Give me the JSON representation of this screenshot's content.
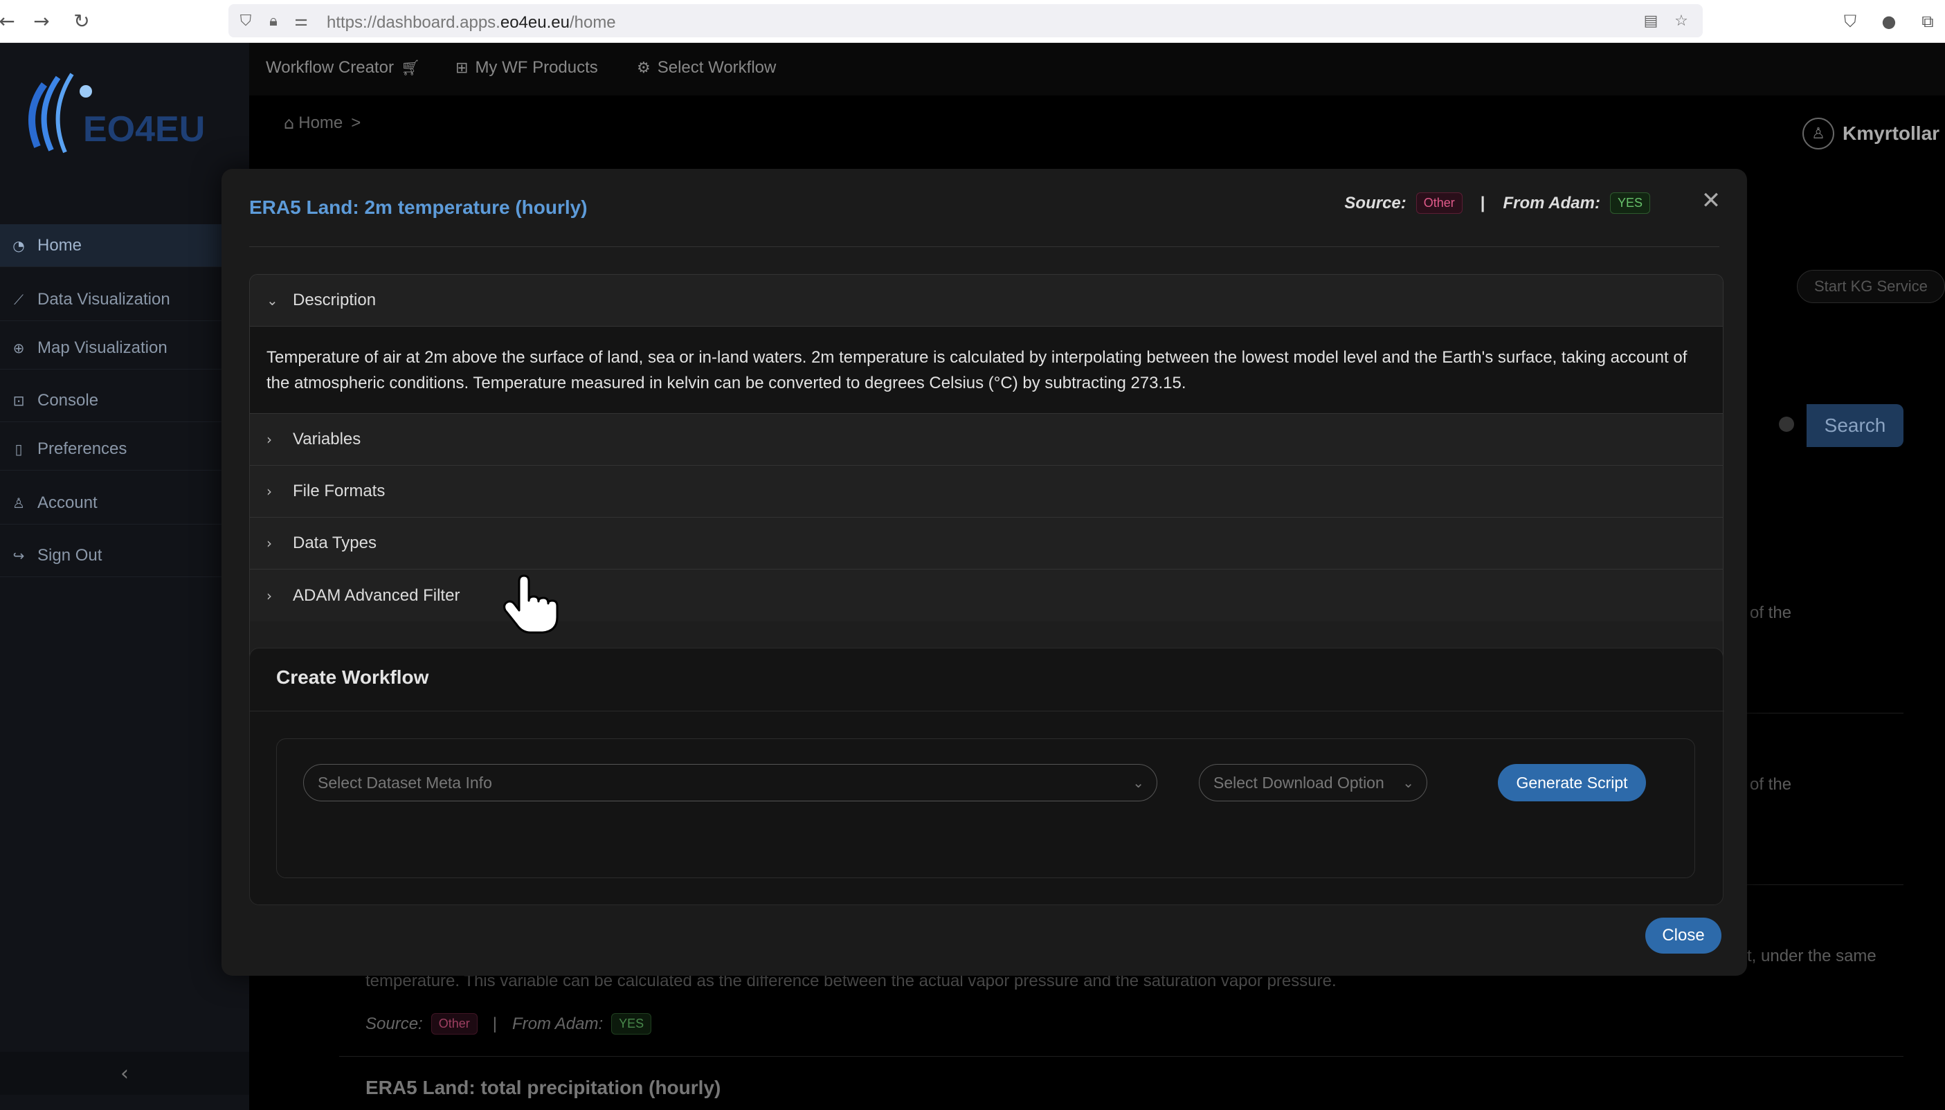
{
  "browser": {
    "url_prefix": "https://dashboard.apps.",
    "url_host": "eo4eu.eu",
    "url_path": "/home"
  },
  "logo": {
    "text": "EO4EU"
  },
  "sidebar": {
    "items": [
      {
        "label": "Home",
        "icon": "dashboard-icon",
        "active": true
      },
      {
        "label": "Data Visualization",
        "icon": "chart-line-icon"
      },
      {
        "label": "Map Visualization",
        "icon": "globe-icon"
      },
      {
        "label": "Console",
        "icon": "terminal-icon"
      },
      {
        "label": "Preferences",
        "icon": "bookmark-icon"
      },
      {
        "label": "Account",
        "icon": "user-icon"
      },
      {
        "label": "Sign Out",
        "icon": "sign-out-icon"
      }
    ]
  },
  "topnav": {
    "workflow_creator": "Workflow Creator",
    "my_wf_products": "My WF Products",
    "select_workflow": "Select Workflow"
  },
  "breadcrumb": {
    "home": "Home",
    "separator": ">"
  },
  "user": {
    "name": "Kmyrtollar"
  },
  "background": {
    "kg_button": "Start KG Service",
    "search_button": "Search",
    "snippet_1": "of the",
    "snippet_2": "of the",
    "snippet_3": "t, under the same",
    "desc_line": "temperature. This variable can be calculated as the difference between the actual vapor pressure and the saturation vapor pressure.",
    "meta_source_label": "Source:",
    "meta_source_value": "Other",
    "meta_sep": "|",
    "meta_adam_label": "From Adam:",
    "meta_adam_value": "YES",
    "next_title": "ERA5 Land: total precipitation (hourly)"
  },
  "modal": {
    "title": "ERA5 Land: 2m temperature (hourly)",
    "source_label": "Source:",
    "source_value": "Other",
    "separator": "|",
    "adam_label": "From Adam:",
    "adam_value": "YES",
    "accordion": [
      {
        "label": "Description",
        "expanded": true
      },
      {
        "label": "Variables",
        "expanded": false
      },
      {
        "label": "File Formats",
        "expanded": false
      },
      {
        "label": "Data Types",
        "expanded": false
      },
      {
        "label": "ADAM Advanced Filter",
        "expanded": false
      }
    ],
    "description_text": "Temperature of air at 2m above the surface of land, sea or in-land waters. 2m temperature is calculated by interpolating between the lowest model level and the Earth's surface, taking account of the atmospheric conditions. Temperature measured in kelvin can be converted to degrees Celsius (°C) by subtracting 273.15.",
    "create_workflow": {
      "title": "Create Workflow",
      "dataset_placeholder": "Select Dataset Meta Info",
      "download_placeholder": "Select Download Option",
      "generate_button": "Generate Script"
    },
    "close_button": "Close"
  },
  "colors": {
    "accent": "#2d6aaa",
    "title_blue": "#5d9bd9",
    "badge_other": "#e05a8a",
    "badge_yes": "#67c26b"
  }
}
